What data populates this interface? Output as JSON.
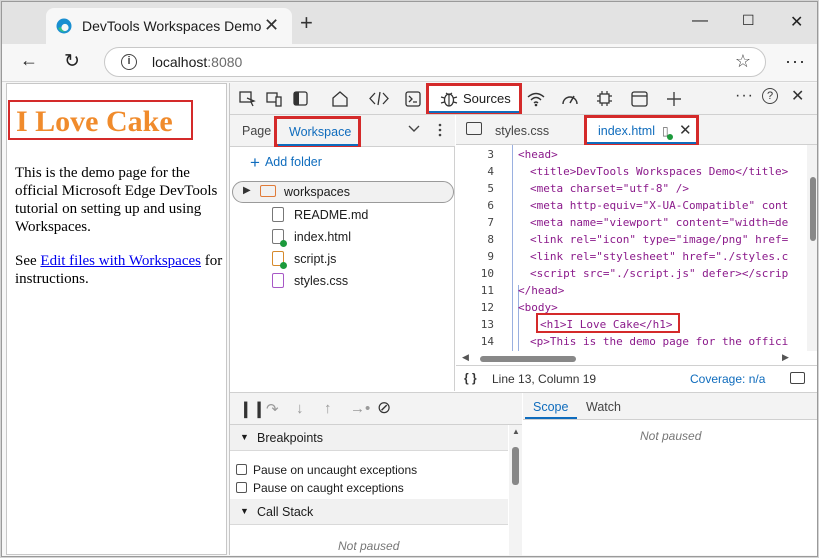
{
  "browser": {
    "tab_title": "DevTools Workspaces Demo",
    "tab_close": "✕",
    "new_tab": "+",
    "window_controls": {
      "minimize": "—",
      "maximize": "☐",
      "close": "✕"
    },
    "back": "←",
    "reload": "↻",
    "url_host": "localhost",
    "url_port": ":8080",
    "info": "i",
    "favorite": "☆",
    "menu": "···"
  },
  "page": {
    "heading": "I Love Cake",
    "paragraph": "This is the demo page for the official Microsoft Edge DevTools tutorial on setting up and using Workspaces.",
    "see_prefix": "See ",
    "link_text": "Edit files with Workspaces",
    "see_suffix": " for instructions."
  },
  "devtools": {
    "sources_label": "Sources",
    "toolbar_more": "···",
    "toolbar_help": "?",
    "toolbar_close": "✕",
    "navigator": {
      "tab_page": "Page",
      "tab_workspace": "Workspace",
      "add_folder": "Add folder",
      "folder": "workspaces",
      "files": [
        {
          "name": "README.md",
          "type": "md",
          "changed": false
        },
        {
          "name": "index.html",
          "type": "html",
          "changed": true
        },
        {
          "name": "script.js",
          "type": "js",
          "changed": true
        },
        {
          "name": "styles.css",
          "type": "css",
          "changed": false
        }
      ]
    },
    "editor": {
      "tab_styles": "styles.css",
      "tab_index": "index.html",
      "lines": [
        {
          "n": "3",
          "html": "<span class='t'>&lt;head&gt;</span>",
          "indent": 0
        },
        {
          "n": "4",
          "indent": 1
        },
        {
          "n": "5",
          "indent": 1
        },
        {
          "n": "6",
          "indent": 1
        },
        {
          "n": "7",
          "indent": 1
        },
        {
          "n": "8",
          "indent": 1
        },
        {
          "n": "9",
          "indent": 1
        },
        {
          "n": "10",
          "indent": 1
        },
        {
          "n": "11",
          "indent": 0
        },
        {
          "n": "12",
          "indent": 0
        },
        {
          "n": "13",
          "indent": 1
        },
        {
          "n": "14",
          "indent": 1
        }
      ],
      "code": [
        "<head>",
        "<title>DevTools Workspaces Demo</title>",
        "<meta charset=\"utf-8\" />",
        "<meta http-equiv=\"X-UA-Compatible\" cont",
        "<meta name=\"viewport\" content=\"width=de",
        "<link rel=\"icon\" type=\"image/png\" href=",
        "<link rel=\"stylesheet\" href=\"./styles.c",
        "<script src=\"./script.js\" defer></scrip",
        "</head>",
        "<body>",
        "<h1>I Love Cake</h1>",
        "<p>This is the demo page for the offici"
      ],
      "line_numbers": [
        "3",
        "4",
        "5",
        "6",
        "7",
        "8",
        "9",
        "10",
        "11",
        "12",
        "13",
        "14"
      ],
      "status_braces": "{ }",
      "status_position": "Line 13, Column 19",
      "status_coverage": "Coverage: n/a"
    },
    "debugger": {
      "breakpoints": "Breakpoints",
      "pause_uncaught": "Pause on uncaught exceptions",
      "pause_caught": "Pause on caught exceptions",
      "call_stack": "Call Stack",
      "not_paused": "Not paused",
      "scope_tab": "Scope",
      "watch_tab": "Watch"
    }
  },
  "colors": {
    "highlight_red": "#d42a2a",
    "accent_blue": "#0f6cbd",
    "heading_orange": "#f08b2c"
  }
}
